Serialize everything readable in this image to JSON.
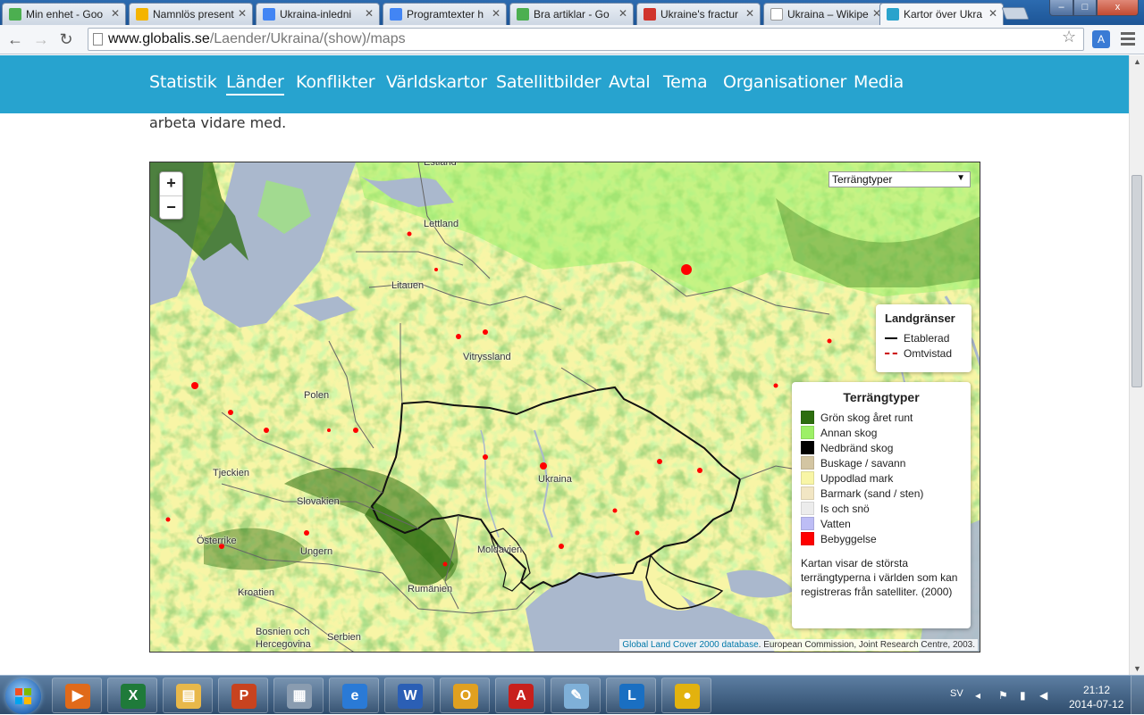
{
  "browser": {
    "tabs": [
      {
        "label": "Min enhet - Goo",
        "icon": "google-drive-icon",
        "color": "#4caf50"
      },
      {
        "label": "Namnlös present",
        "icon": "google-slides-icon",
        "color": "#f4b400"
      },
      {
        "label": "Ukraina-inledni",
        "icon": "google-docs-icon",
        "color": "#4285f4"
      },
      {
        "label": "Programtexter h",
        "icon": "google-docs-icon",
        "color": "#4285f4"
      },
      {
        "label": "Bra artiklar - Go",
        "icon": "google-drive-icon",
        "color": "#4caf50"
      },
      {
        "label": "Ukraine's fractur",
        "icon": "pdf-icon",
        "color": "#d0342c"
      },
      {
        "label": "Ukraina – Wikipe",
        "icon": "wikipedia-icon",
        "color": "#ffffff"
      },
      {
        "label": "Kartor över Ukra",
        "icon": "globalis-icon",
        "color": "#2aa3cc"
      }
    ],
    "active_tab": 7,
    "url_host": "www.globalis.se",
    "url_path": "/Laender/Ukraina/(show)/maps",
    "window_buttons": {
      "minimize": "–",
      "maximize": "□",
      "close": "x"
    }
  },
  "site_nav": [
    {
      "label": "Statistik"
    },
    {
      "label": "Länder",
      "current": true
    },
    {
      "label": "Konflikter"
    },
    {
      "label": "Världskartor"
    },
    {
      "label": "Satellitbilder"
    },
    {
      "label": "Avtal"
    },
    {
      "label": "Tema"
    },
    {
      "label": "Organisationer"
    },
    {
      "label": "Media"
    }
  ],
  "intro_text": "arbeta vidare med.",
  "map": {
    "zoom_in": "+",
    "zoom_out": "−",
    "layer_select": "Terrängtyper",
    "labels": [
      "Estland",
      "Lettland",
      "Litauen",
      "Vitryssland",
      "Polen",
      "Ukraina",
      "Tjeckien",
      "Slovakien",
      "Österrike",
      "Ungern",
      "Moldavien",
      "Rumänien",
      "Kroatien",
      "Bosnien och",
      "Hercegovina",
      "Serbien"
    ],
    "borders_legend": {
      "title": "Landgränser",
      "items": [
        {
          "label": "Etablerad",
          "color": "#000000",
          "style": "solid"
        },
        {
          "label": "Omtvistad",
          "color": "#cc0000",
          "style": "dashed"
        }
      ]
    },
    "terrain_legend": {
      "title": "Terrängtyper",
      "items": [
        {
          "label": "Grön skog året runt",
          "color": "#2d6e0f"
        },
        {
          "label": "Annan skog",
          "color": "#9df067"
        },
        {
          "label": "Nedbränd skog",
          "color": "#000000"
        },
        {
          "label": "Buskage / savann",
          "color": "#d3c5a2"
        },
        {
          "label": "Uppodlad mark",
          "color": "#f8f5a6"
        },
        {
          "label": "Barmark (sand / sten)",
          "color": "#f2e6c4"
        },
        {
          "label": "Is och snö",
          "color": "#ececec"
        },
        {
          "label": "Vatten",
          "color": "#bdbdf5"
        },
        {
          "label": "Bebyggelse",
          "color": "#ff0000"
        }
      ],
      "note": "Kartan visar de största terrängtyperna i världen som kan registreras från satelliter. (2000)"
    },
    "attribution_link": "Global Land Cover 2000 database",
    "attribution_text": ". European Commission, Joint Research Centre, 2003."
  },
  "taskbar": {
    "apps": [
      {
        "name": "media-player",
        "glyph": "▶",
        "color": "#e06a1a"
      },
      {
        "name": "excel",
        "glyph": "X",
        "color": "#1f7a3a"
      },
      {
        "name": "explorer",
        "glyph": "▤",
        "color": "#e8b84a"
      },
      {
        "name": "powerpoint",
        "glyph": "P",
        "color": "#c8431f"
      },
      {
        "name": "calculator",
        "glyph": "▦",
        "color": "#8a9cb0"
      },
      {
        "name": "internet-explorer",
        "glyph": "e",
        "color": "#2a7ad6"
      },
      {
        "name": "word",
        "glyph": "W",
        "color": "#2b5fb5"
      },
      {
        "name": "outlook",
        "glyph": "O",
        "color": "#e0a020"
      },
      {
        "name": "acrobat",
        "glyph": "A",
        "color": "#c8201c"
      },
      {
        "name": "notes",
        "glyph": "✎",
        "color": "#7fb0d8"
      },
      {
        "name": "lync",
        "glyph": "L",
        "color": "#1a6fc2"
      },
      {
        "name": "chrome",
        "glyph": "●",
        "color": "#e2b20e"
      }
    ],
    "language": "SV",
    "time": "21:12",
    "date": "2014-07-12"
  }
}
